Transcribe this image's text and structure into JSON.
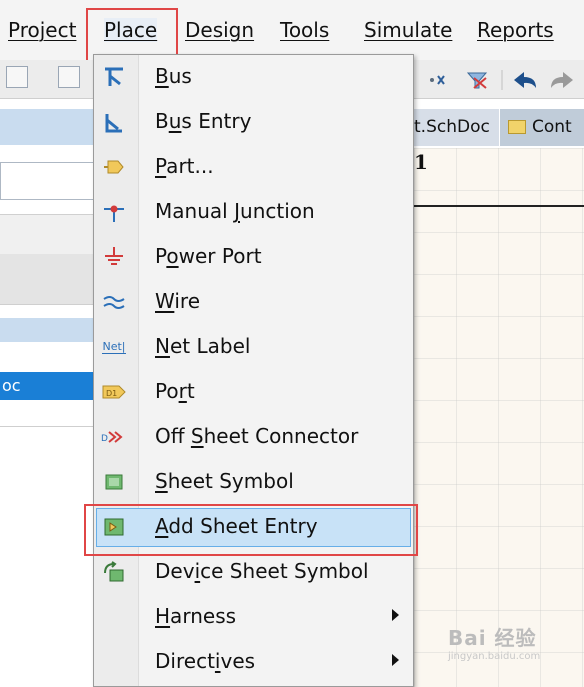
{
  "menubar": {
    "items": [
      "Project",
      "Place",
      "Design",
      "Tools",
      "Simulate",
      "Reports"
    ],
    "active": "Place"
  },
  "left_panel": {
    "selected_text": "oc"
  },
  "document": {
    "tab_active": "t.SchDoc",
    "tab_other": "Cont",
    "sheet_marker": "1"
  },
  "place_menu": {
    "items": [
      {
        "label": "Bus",
        "icon": "bus-icon"
      },
      {
        "label": "Bus Entry",
        "icon": "bus-entry-icon"
      },
      {
        "label": "Part...",
        "icon": "part-icon"
      },
      {
        "label": "Manual Junction",
        "icon": "junction-icon"
      },
      {
        "label": "Power Port",
        "icon": "power-port-icon"
      },
      {
        "label": "Wire",
        "icon": "wire-icon"
      },
      {
        "label": "Net Label",
        "icon": "net-label-icon"
      },
      {
        "label": "Port",
        "icon": "port-icon"
      },
      {
        "label": "Off Sheet Connector",
        "icon": "off-sheet-connector-icon"
      },
      {
        "label": "Sheet Symbol",
        "icon": "sheet-symbol-icon"
      },
      {
        "label": "Add Sheet Entry",
        "icon": "sheet-entry-icon",
        "selected": true
      },
      {
        "label": "Device Sheet Symbol",
        "icon": "device-sheet-symbol-icon"
      },
      {
        "label": "Harness",
        "icon": "",
        "submenu": true
      },
      {
        "label": "Directives",
        "icon": "",
        "submenu": true
      }
    ]
  },
  "watermark": {
    "text": "Bai 经验",
    "sub": "jingyan.baidu.com"
  },
  "colors": {
    "highlight_border": "#e04646",
    "selection_fill": "#c8e2f7",
    "tree_selection": "#1a7fd6"
  }
}
